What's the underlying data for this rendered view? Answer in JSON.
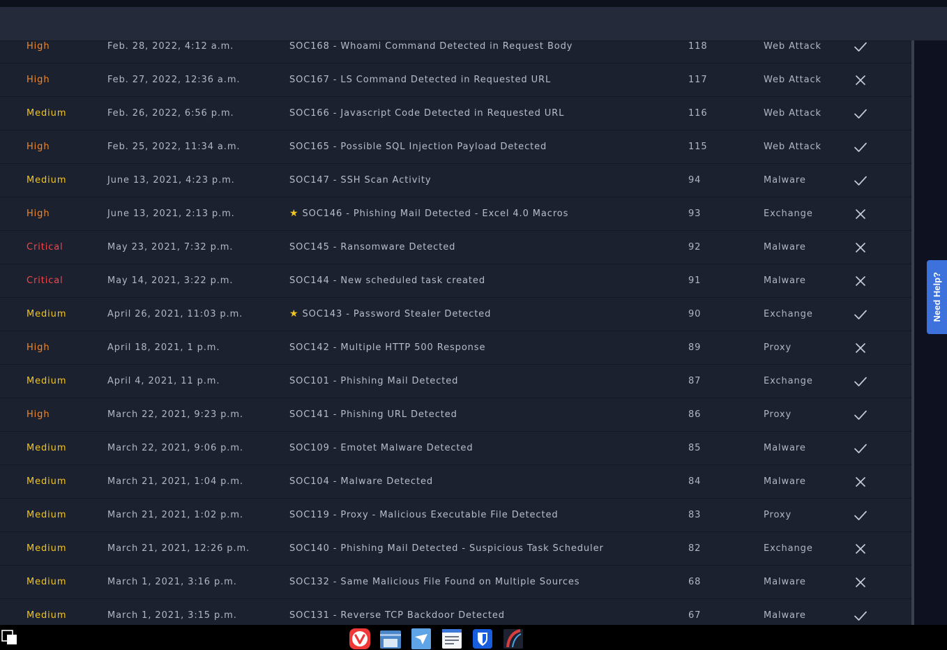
{
  "alerts": [
    {
      "severity": "High",
      "level": "high",
      "date": "Feb. 28, 2022, 4:12 a.m.",
      "rule": "SOC168 - Whoami Command Detected in Request Body",
      "starred": false,
      "event_id": "118",
      "type": "Web Attack",
      "status": "check"
    },
    {
      "severity": "High",
      "level": "high",
      "date": "Feb. 27, 2022, 12:36 a.m.",
      "rule": "SOC167 - LS Command Detected in Requested URL",
      "starred": false,
      "event_id": "117",
      "type": "Web Attack",
      "status": "cross"
    },
    {
      "severity": "Medium",
      "level": "medium",
      "date": "Feb. 26, 2022, 6:56 p.m.",
      "rule": "SOC166 - Javascript Code Detected in Requested URL",
      "starred": false,
      "event_id": "116",
      "type": "Web Attack",
      "status": "check"
    },
    {
      "severity": "High",
      "level": "high",
      "date": "Feb. 25, 2022, 11:34 a.m.",
      "rule": "SOC165 - Possible SQL Injection Payload Detected",
      "starred": false,
      "event_id": "115",
      "type": "Web Attack",
      "status": "check"
    },
    {
      "severity": "Medium",
      "level": "medium",
      "date": "June 13, 2021, 4:23 p.m.",
      "rule": "SOC147 - SSH Scan Activity",
      "starred": false,
      "event_id": "94",
      "type": "Malware",
      "status": "check"
    },
    {
      "severity": "High",
      "level": "high",
      "date": "June 13, 2021, 2:13 p.m.",
      "rule": "SOC146 - Phishing Mail Detected - Excel 4.0 Macros",
      "starred": true,
      "event_id": "93",
      "type": "Exchange",
      "status": "cross"
    },
    {
      "severity": "Critical",
      "level": "critical",
      "date": "May 23, 2021, 7:32 p.m.",
      "rule": "SOC145 - Ransomware Detected",
      "starred": false,
      "event_id": "92",
      "type": "Malware",
      "status": "cross"
    },
    {
      "severity": "Critical",
      "level": "critical",
      "date": "May 14, 2021, 3:22 p.m.",
      "rule": "SOC144 - New scheduled task created",
      "starred": false,
      "event_id": "91",
      "type": "Malware",
      "status": "cross"
    },
    {
      "severity": "Medium",
      "level": "medium",
      "date": "April 26, 2021, 11:03 p.m.",
      "rule": "SOC143 - Password Stealer Detected",
      "starred": true,
      "event_id": "90",
      "type": "Exchange",
      "status": "check"
    },
    {
      "severity": "High",
      "level": "high",
      "date": "April 18, 2021, 1 p.m.",
      "rule": "SOC142 - Multiple HTTP 500 Response",
      "starred": false,
      "event_id": "89",
      "type": "Proxy",
      "status": "cross"
    },
    {
      "severity": "Medium",
      "level": "medium",
      "date": "April 4, 2021, 11 p.m.",
      "rule": "SOC101 - Phishing Mail Detected",
      "starred": false,
      "event_id": "87",
      "type": "Exchange",
      "status": "check"
    },
    {
      "severity": "High",
      "level": "high",
      "date": "March 22, 2021, 9:23 p.m.",
      "rule": "SOC141 - Phishing URL Detected",
      "starred": false,
      "event_id": "86",
      "type": "Proxy",
      "status": "check"
    },
    {
      "severity": "Medium",
      "level": "medium",
      "date": "March 22, 2021, 9:06 p.m.",
      "rule": "SOC109 - Emotet Malware Detected",
      "starred": false,
      "event_id": "85",
      "type": "Malware",
      "status": "check"
    },
    {
      "severity": "Medium",
      "level": "medium",
      "date": "March 21, 2021, 1:04 p.m.",
      "rule": "SOC104 - Malware Detected",
      "starred": false,
      "event_id": "84",
      "type": "Malware",
      "status": "cross"
    },
    {
      "severity": "Medium",
      "level": "medium",
      "date": "March 21, 2021, 1:02 p.m.",
      "rule": "SOC119 - Proxy - Malicious Executable File Detected",
      "starred": false,
      "event_id": "83",
      "type": "Proxy",
      "status": "check"
    },
    {
      "severity": "Medium",
      "level": "medium",
      "date": "March 21, 2021, 12:26 p.m.",
      "rule": "SOC140 - Phishing Mail Detected - Suspicious Task Scheduler",
      "starred": false,
      "event_id": "82",
      "type": "Exchange",
      "status": "cross"
    },
    {
      "severity": "Medium",
      "level": "medium",
      "date": "March 1, 2021, 3:16 p.m.",
      "rule": "SOC132 - Same Malicious File Found on Multiple Sources",
      "starred": false,
      "event_id": "68",
      "type": "Malware",
      "status": "cross"
    },
    {
      "severity": "Medium",
      "level": "medium",
      "date": "March 1, 2021, 3:15 p.m.",
      "rule": "SOC131 - Reverse TCP Backdoor Detected",
      "starred": false,
      "event_id": "67",
      "type": "Malware",
      "status": "check"
    }
  ],
  "help_button": {
    "label": "Need Help?"
  },
  "colors": {
    "high": "#f08a2c",
    "medium": "#f3c61c",
    "critical": "#f0484a",
    "accent": "#3d72dd"
  },
  "taskbar": {
    "left_icon": "window-switcher-icon",
    "apps": [
      "vivaldi-browser-icon",
      "file-manager-icon",
      "mail-client-icon",
      "text-editor-icon",
      "bitwarden-icon",
      "terminal-icon"
    ]
  }
}
